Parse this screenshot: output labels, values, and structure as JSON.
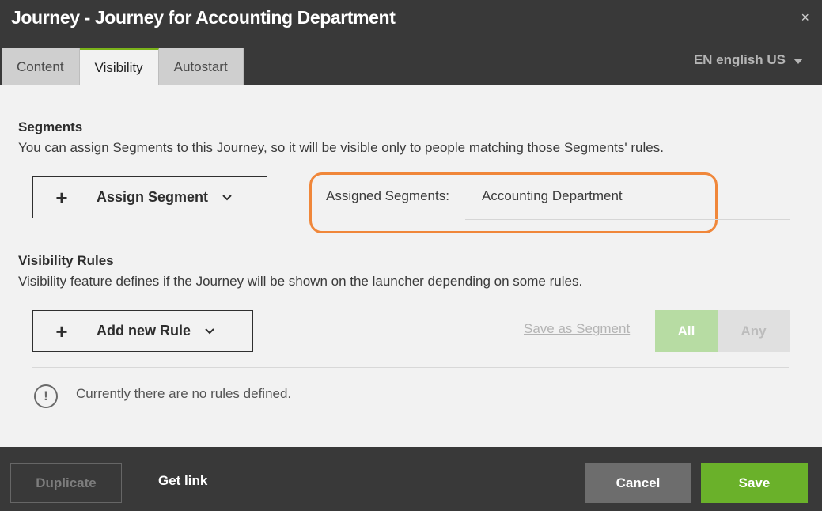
{
  "window": {
    "title": "Journey - Journey for Accounting Department",
    "close_icon": "×"
  },
  "tabs": [
    {
      "label": "Content"
    },
    {
      "label": "Visibility",
      "active": true
    },
    {
      "label": "Autostart"
    }
  ],
  "language": {
    "selected": "EN english US"
  },
  "segments": {
    "title": "Segments",
    "description": "You can assign Segments to this Journey, so it will be visible only to people matching those Segments' rules.",
    "assign_button": "Assign Segment",
    "assigned_label": "Assigned Segments:",
    "assigned_value": "Accounting Department"
  },
  "visibility_rules": {
    "title": "Visibility Rules",
    "description": "Visibility feature defines if the Journey will be shown on the launcher depending on some rules.",
    "add_button": "Add new Rule",
    "save_as_segment": "Save as Segment",
    "match_all": "All",
    "match_any": "Any",
    "selected_match": "All",
    "empty_message": "Currently there are no rules defined.",
    "info_icon": "!"
  },
  "footer": {
    "duplicate": "Duplicate",
    "get_link": "Get link",
    "cancel": "Cancel",
    "save": "Save"
  },
  "icons": {
    "plus": "+",
    "chevron": "⌄"
  },
  "colors": {
    "accent_green": "#6ab12a",
    "highlight_orange": "#f0873a",
    "header_bg": "#393939"
  }
}
